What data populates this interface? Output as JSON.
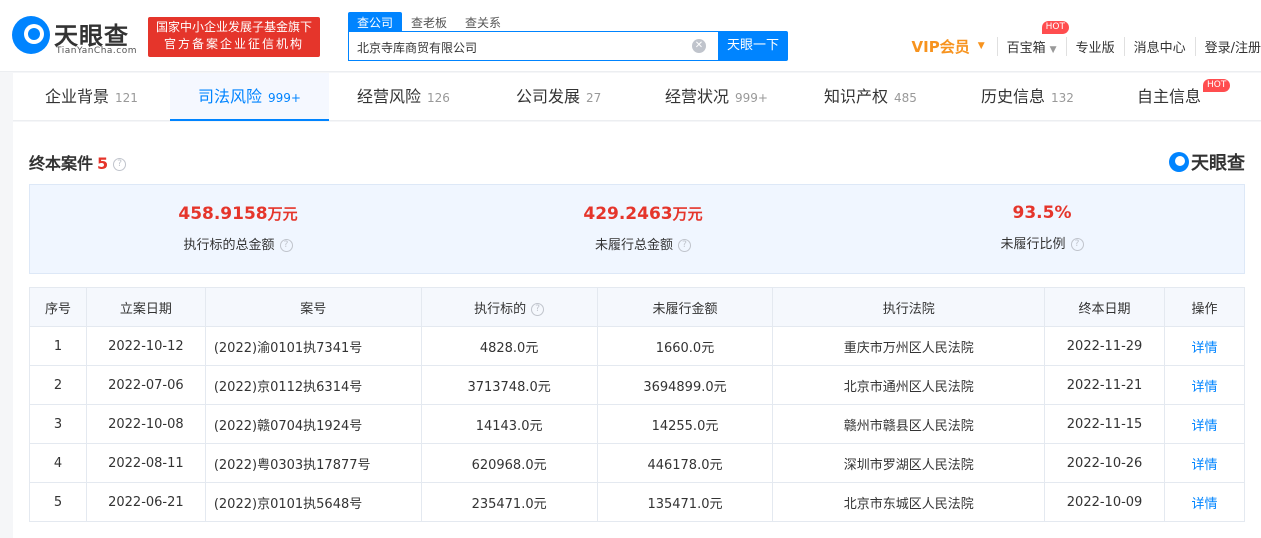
{
  "brand": {
    "name_cn": "天眼查",
    "name_en": "TianYanCha.com",
    "watermark": "天眼查",
    "accent": "#0084ff"
  },
  "badge": {
    "line1": "国家中小企业发展子基金旗下",
    "line2": "官方备案企业征信机构"
  },
  "search": {
    "tabs": [
      {
        "label": "查公司",
        "active": true
      },
      {
        "label": "查老板",
        "active": false
      },
      {
        "label": "查关系",
        "active": false
      }
    ],
    "value": "北京寺库商贸有限公司",
    "button": "天眼一下",
    "clear_icon": "clear-icon"
  },
  "topnav": {
    "vip": "VIP会员",
    "baobao": "百宝箱",
    "hot": "HOT",
    "pro": "专业版",
    "messages": "消息中心",
    "login": "登录/注册"
  },
  "categories": [
    {
      "label": "企业背景",
      "count": "121"
    },
    {
      "label": "司法风险",
      "count": "999+",
      "active": true
    },
    {
      "label": "经营风险",
      "count": "126"
    },
    {
      "label": "公司发展",
      "count": "27"
    },
    {
      "label": "经营状况",
      "count": "999+"
    },
    {
      "label": "知识产权",
      "count": "485"
    },
    {
      "label": "历史信息",
      "count": "132"
    },
    {
      "label": "自主信息",
      "count": "",
      "hot": "HOT"
    }
  ],
  "section": {
    "title": "终本案件",
    "count": "5",
    "help_icon": "question-icon"
  },
  "stats": [
    {
      "value": "458.9158",
      "unit": "万元",
      "label": "执行标的总金额"
    },
    {
      "value": "429.2463",
      "unit": "万元",
      "label": "未履行总金额"
    },
    {
      "value": "93.5%",
      "unit": "",
      "label": "未履行比例"
    }
  ],
  "table": {
    "headers": [
      "序号",
      "立案日期",
      "案号",
      "执行标的",
      "未履行金额",
      "执行法院",
      "终本日期",
      "操作"
    ],
    "rows": [
      [
        "1",
        "2022-10-12",
        "(2022)渝0101执7341号",
        "4828.0元",
        "1660.0元",
        "重庆市万州区人民法院",
        "2022-11-29",
        "详情"
      ],
      [
        "2",
        "2022-07-06",
        "(2022)京0112执6314号",
        "3713748.0元",
        "3694899.0元",
        "北京市通州区人民法院",
        "2022-11-21",
        "详情"
      ],
      [
        "3",
        "2022-10-08",
        "(2022)赣0704执1924号",
        "14143.0元",
        "14255.0元",
        "赣州市赣县区人民法院",
        "2022-11-15",
        "详情"
      ],
      [
        "4",
        "2022-08-11",
        "(2022)粤0303执17877号",
        "620968.0元",
        "446178.0元",
        "深圳市罗湖区人民法院",
        "2022-10-26",
        "详情"
      ],
      [
        "5",
        "2022-06-21",
        "(2022)京0101执5648号",
        "235471.0元",
        "135471.0元",
        "北京市东城区人民法院",
        "2022-10-09",
        "详情"
      ]
    ]
  }
}
